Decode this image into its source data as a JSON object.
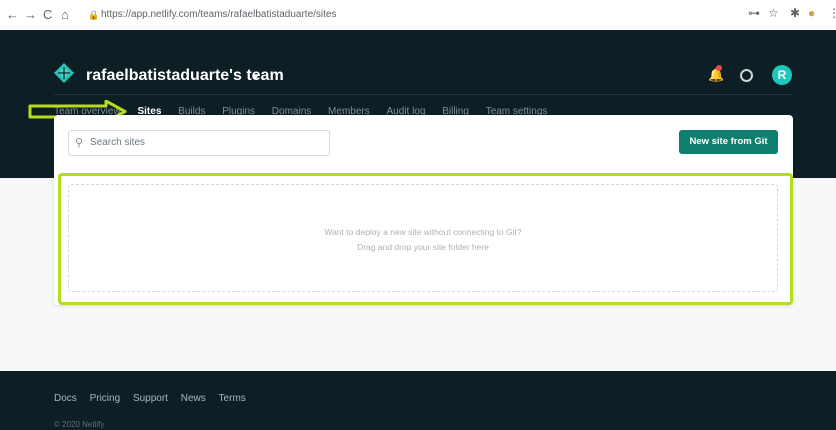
{
  "browser": {
    "url": "https://app.netlify.com/teams/rafaelbatistaduarte/sites",
    "back_glyph": "←",
    "forward_glyph": "→",
    "reload_glyph": "C",
    "home_glyph": "⌂",
    "lock_glyph": "🔒",
    "key_glyph": "⊶",
    "star_glyph": "☆",
    "puzzle_glyph": "✱",
    "profile_glyph": "●",
    "menu_glyph": "⋮"
  },
  "header": {
    "team_name": "rafaelbatistaduarte's team",
    "caret": "▾",
    "bell_glyph": "🔔",
    "avatar_initial": "R",
    "brand_color": "#20c6b7"
  },
  "tabs": [
    {
      "label": "Team overview"
    },
    {
      "label": "Sites"
    },
    {
      "label": "Builds"
    },
    {
      "label": "Plugins"
    },
    {
      "label": "Domains"
    },
    {
      "label": "Members"
    },
    {
      "label": "Audit log"
    },
    {
      "label": "Billing"
    },
    {
      "label": "Team settings"
    }
  ],
  "active_tab": "Sites",
  "annotation_color": "#b6dc1f",
  "card": {
    "search_placeholder": "Search sites",
    "search_glyph": "⚲",
    "new_site_label": "New site from Git",
    "dropzone_line1": "Want to deploy a new site without connecting to Git?",
    "dropzone_line2": "Drag and drop your site folder here"
  },
  "footer": {
    "links": [
      "Docs",
      "Pricing",
      "Support",
      "News",
      "Terms"
    ],
    "copyright": "© 2020 Netlify"
  }
}
